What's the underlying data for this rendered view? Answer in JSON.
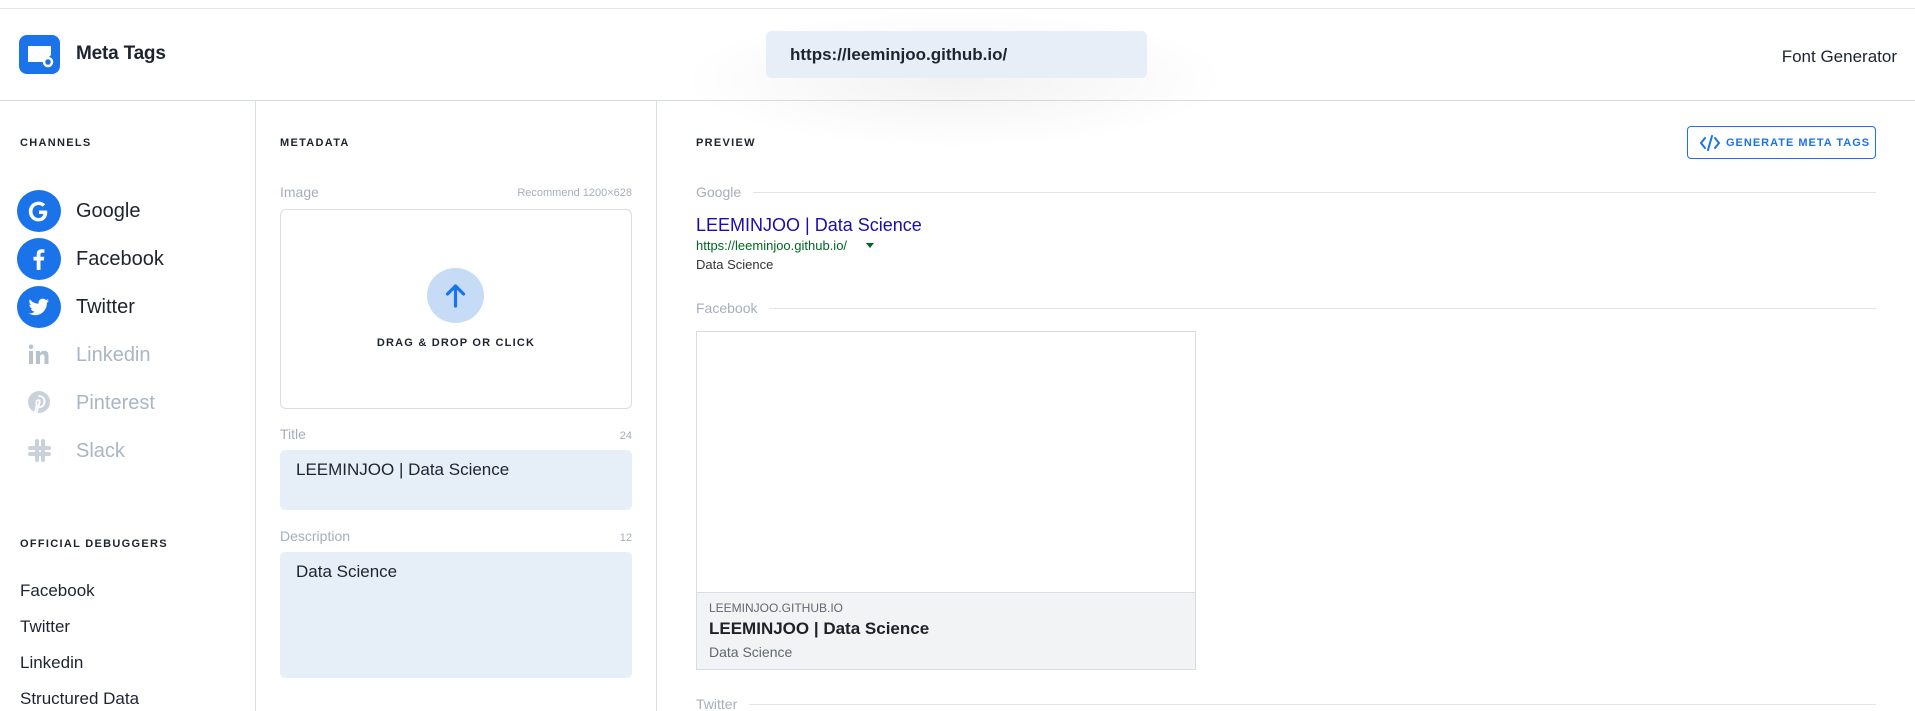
{
  "header": {
    "brand": "Meta Tags",
    "url_value": "https://leeminjoo.github.io/",
    "font_generator": "Font Generator"
  },
  "sidebar": {
    "channels_title": "CHANNELS",
    "channels": [
      {
        "label": "Google",
        "icon": "google-icon",
        "active": true
      },
      {
        "label": "Facebook",
        "icon": "facebook-icon",
        "active": true
      },
      {
        "label": "Twitter",
        "icon": "twitter-icon",
        "active": true
      },
      {
        "label": "Linkedin",
        "icon": "linkedin-icon",
        "active": false
      },
      {
        "label": "Pinterest",
        "icon": "pinterest-icon",
        "active": false
      },
      {
        "label": "Slack",
        "icon": "slack-icon",
        "active": false
      }
    ],
    "debuggers_title": "OFFICIAL DEBUGGERS",
    "debuggers": [
      "Facebook",
      "Twitter",
      "Linkedin",
      "Structured Data"
    ]
  },
  "metadata": {
    "title": "METADATA",
    "image_label": "Image",
    "image_hint": "Recommend 1200×628",
    "dropzone_text": "DRAG & DROP OR CLICK",
    "title_label": "Title",
    "title_count": "24",
    "title_value": "LEEMINJOO | Data Science",
    "description_label": "Description",
    "description_count": "12",
    "description_value": "Data Science"
  },
  "preview": {
    "title": "PREVIEW",
    "generate_button": "GENERATE META TAGS",
    "google_label": "Google",
    "google": {
      "title": "LEEMINJOO | Data Science",
      "url": "https://leeminjoo.github.io/",
      "description": "Data Science"
    },
    "facebook_label": "Facebook",
    "facebook": {
      "domain": "LEEMINJOO.GITHUB.IO",
      "title": "LEEMINJOO | Data Science",
      "description": "Data Science"
    },
    "twitter_label": "Twitter"
  },
  "colors": {
    "accent": "#1a73e8",
    "google_link": "#1a0dab",
    "google_url": "#006621",
    "muted": "#a4afbb"
  }
}
